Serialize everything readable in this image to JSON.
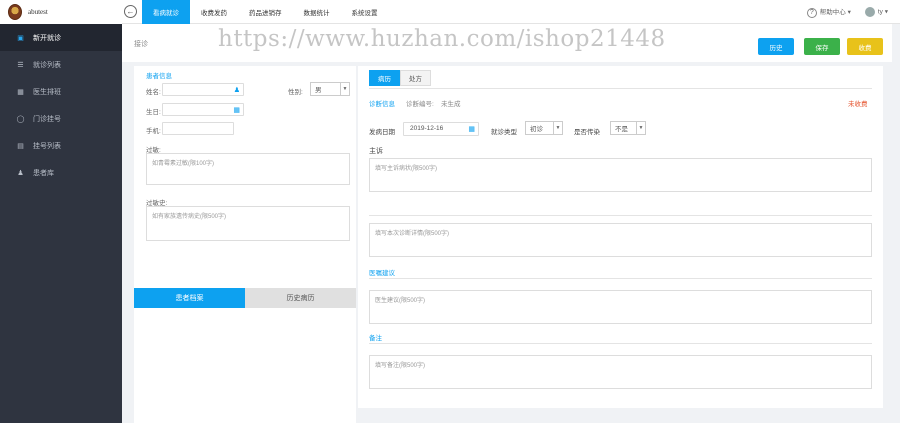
{
  "brand": {
    "name": "abutest"
  },
  "topnav": {
    "back_icon": "arrow-left-circle-icon",
    "tabs": [
      "看病就诊",
      "收费发药",
      "药品进销存",
      "数据统计",
      "系统设置"
    ],
    "active_index": 0,
    "help": "帮助中心",
    "user": "ty"
  },
  "sidebar": {
    "items": [
      {
        "label": "新开就诊",
        "icon": "camera-icon"
      },
      {
        "label": "就诊列表",
        "icon": "list-icon"
      },
      {
        "label": "医生排班",
        "icon": "calendar-icon"
      },
      {
        "label": "门诊挂号",
        "icon": "tag-icon"
      },
      {
        "label": "挂号列表",
        "icon": "card-icon"
      },
      {
        "label": "患者库",
        "icon": "person-icon"
      }
    ],
    "active_index": 0
  },
  "page": {
    "title": "接诊",
    "watermark": "https://www.huzhan.com/ishop21448",
    "buttons": {
      "history": "历史",
      "save": "保存",
      "charge": "收费"
    }
  },
  "patient": {
    "section_title": "患者信息",
    "name_label": "姓名:",
    "gender_label": "性别:",
    "gender_value": "男",
    "birth_label": "生日:",
    "phone_label": "手机:",
    "allergy_label": "过敏:",
    "allergy_placeholder": "如青霉素过敏(限100字)",
    "history_label": "过敏史:",
    "history_placeholder": "如有家族遗传病史(限500字)",
    "tabs": [
      "患者档案",
      "历史病历"
    ]
  },
  "record": {
    "tabs": [
      "病历",
      "处方"
    ],
    "diag_info": "诊断信息",
    "diag_no_label": "诊断编号:",
    "diag_no_value": "未生成",
    "status": "未收费",
    "visit_date_label": "发病日期",
    "visit_date": "2019-12-16",
    "visit_type_label": "就诊类型",
    "visit_type": "初诊",
    "infectious_label": "是否传染",
    "infectious": "不是",
    "chief_label": "主诉",
    "chief_placeholder": "填写主诉病状(限500字)",
    "present_placeholder": "填写本次诊断详情(限500字)",
    "advice_label": "医嘱建议",
    "advice_placeholder": "医生建议(限500字)",
    "remark_label": "备注",
    "remark_placeholder": "填写备注(限500字)"
  },
  "colors": {
    "accent": "#0da1f0",
    "save": "#3bb14a",
    "charge": "#e8c21a",
    "sidebar": "#2f3440"
  }
}
